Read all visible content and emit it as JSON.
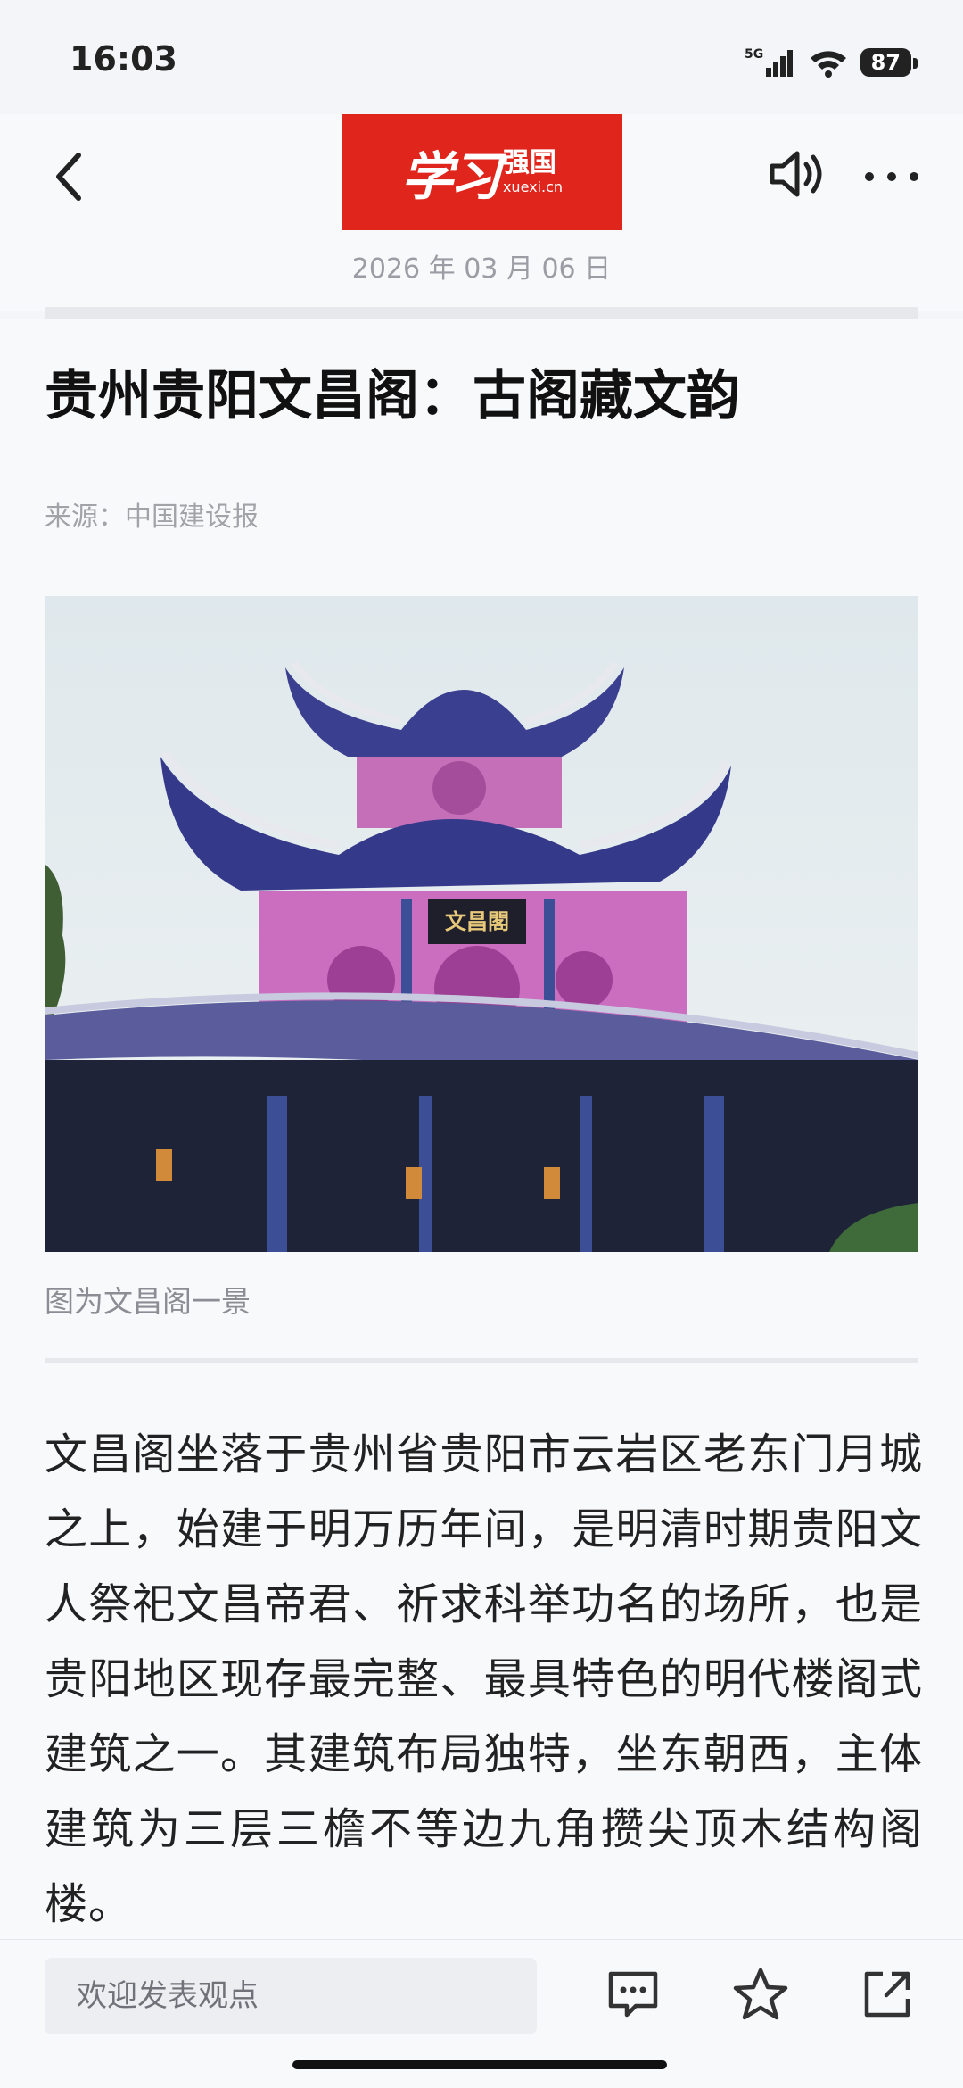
{
  "status_bar": {
    "time": "16:03",
    "network": "5G",
    "battery": "87"
  },
  "header": {
    "logo_brush": "学习",
    "logo_name": "强国",
    "logo_url": "xuexi.cn",
    "date": "2026 年 03 月 06 日"
  },
  "article": {
    "title": "贵州贵阳文昌阁：古阁藏文韵",
    "source": "来源：中国建设报",
    "photo_sign": "文昌閣",
    "caption": "图为文昌阁一景",
    "body": "文昌阁坐落于贵州省贵阳市云岩区老东门月城之上，始建于明万历年间，是明清时期贵阳文人祭祀文昌帝君、祈求科举功名的场所，也是贵阳地区现存最完整、最具特色的明代楼阁式建筑之一。其建筑布局独特，坐东朝西，主体建筑为三层三檐不等边九角攒尖顶木结构阁楼。"
  },
  "bottom_bar": {
    "comment_placeholder": "欢迎发表观点"
  },
  "icons": {
    "back": "chevron-left-icon",
    "speaker": "speaker-icon",
    "more": "more-dots-icon",
    "comment": "comment-icon",
    "favorite": "star-icon",
    "share": "share-icon"
  },
  "colors": {
    "brand_red": "#e0251c",
    "background": "#f8f9fb",
    "text": "#222222",
    "muted": "#a0a3a8"
  }
}
